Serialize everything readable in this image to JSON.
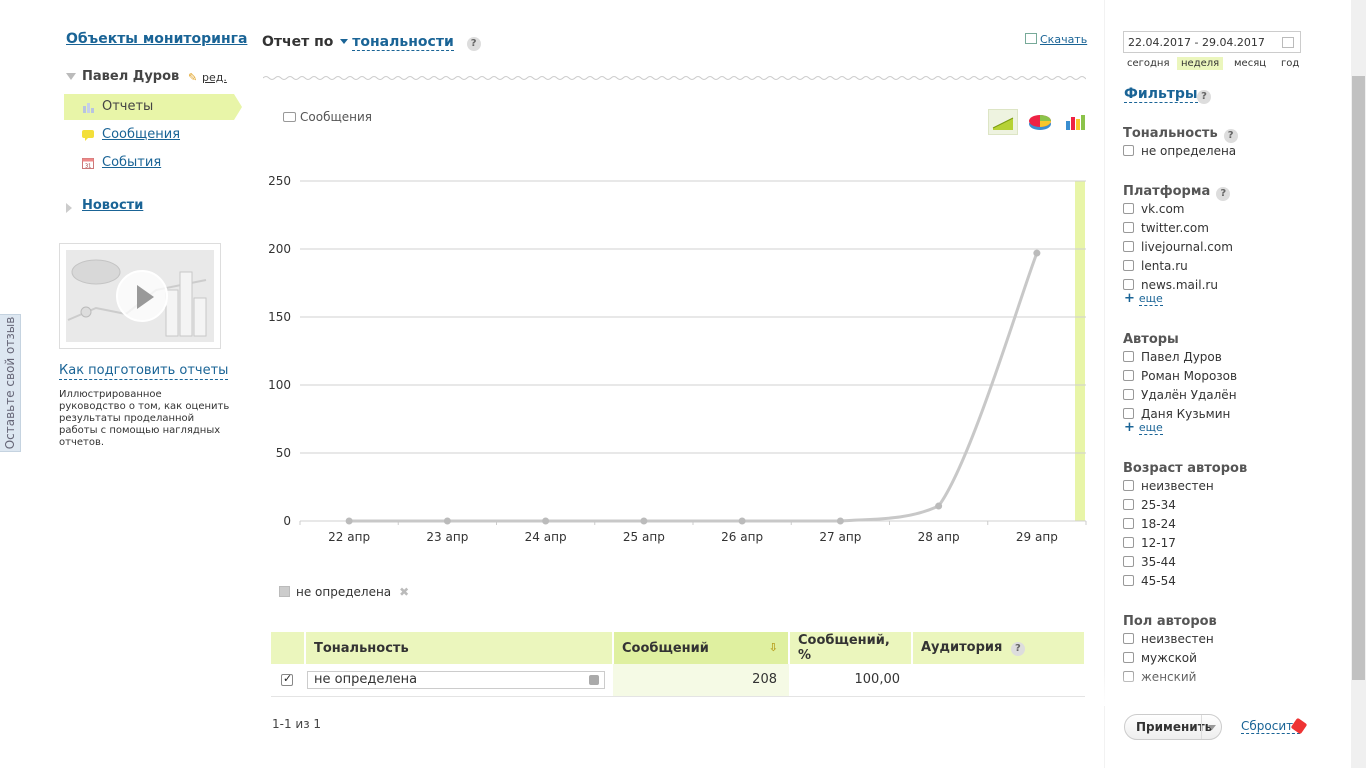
{
  "feedback": {
    "label": "Оставьте свой отзыв"
  },
  "nav": {
    "title": "Объекты мониторинга",
    "user": "Павел Дуров",
    "edit": "ред.",
    "items": [
      {
        "label": "Отчеты",
        "icon": "bar-chart-icon"
      },
      {
        "label": "Сообщения",
        "icon": "speech-bubble-icon"
      },
      {
        "label": "События",
        "icon": "calendar-icon"
      }
    ],
    "news": "Новости",
    "guide_link": "Как подготовить отчеты",
    "guide_text": "Иллюстрированное руководство о том, как оценить результаты проделанной работы с помощью наглядных отчетов."
  },
  "header": {
    "title_prefix": "Отчет по",
    "title_select": "тональности",
    "help": "?",
    "download": "Скачать"
  },
  "chart_header": {
    "series_label": "Сообщения"
  },
  "chart_data": {
    "type": "line",
    "x": [
      "22 апр",
      "23 апр",
      "24 апр",
      "25 апр",
      "26 апр",
      "27 апр",
      "28 апр",
      "29 апр"
    ],
    "series": [
      {
        "name": "не определена",
        "values": [
          0,
          0,
          0,
          0,
          0,
          0,
          11,
          197
        ]
      }
    ],
    "ylim": [
      0,
      250
    ],
    "yticks": [
      0,
      50,
      100,
      150,
      200,
      250
    ],
    "grid": true,
    "colors": {
      "line": "#c8c8c8",
      "grid": "#d0d0d0",
      "highlight": "#e8f5a8"
    }
  },
  "legend": {
    "label": "не определена",
    "remove": "✖"
  },
  "table": {
    "headers": [
      "Тональность",
      "Сообщений",
      "Сообщений, %",
      "Аудитория"
    ],
    "rows": [
      {
        "tone": "не определена",
        "count": "208",
        "pct": "100,00",
        "audience": ""
      }
    ]
  },
  "pager": "1-1 из 1",
  "right": {
    "date_range": "22.04.2017 - 29.04.2017",
    "periods": [
      "сегодня",
      "неделя",
      "месяц",
      "год"
    ],
    "filters_title": "Фильтры",
    "groups": [
      {
        "title": "Тональность",
        "help": true,
        "items": [
          "не определена"
        ]
      },
      {
        "title": "Платформа",
        "help": true,
        "items": [
          "vk.com",
          "twitter.com",
          "livejournal.com",
          "lenta.ru",
          "news.mail.ru"
        ],
        "more": "еще"
      },
      {
        "title": "Авторы",
        "help": false,
        "items": [
          "Павел Дуров",
          "Роман Морозов",
          "Удалён Удалён",
          "Даня Кузьмин"
        ],
        "more": "еще"
      },
      {
        "title": "Возраст авторов",
        "help": false,
        "items": [
          "неизвестен",
          "25-34",
          "18-24",
          "12-17",
          "35-44",
          "45-54"
        ]
      },
      {
        "title": "Пол авторов",
        "help": false,
        "items": [
          "неизвестен",
          "мужской",
          "женский"
        ]
      }
    ],
    "apply": "Применить",
    "reset": "Сбросить"
  }
}
